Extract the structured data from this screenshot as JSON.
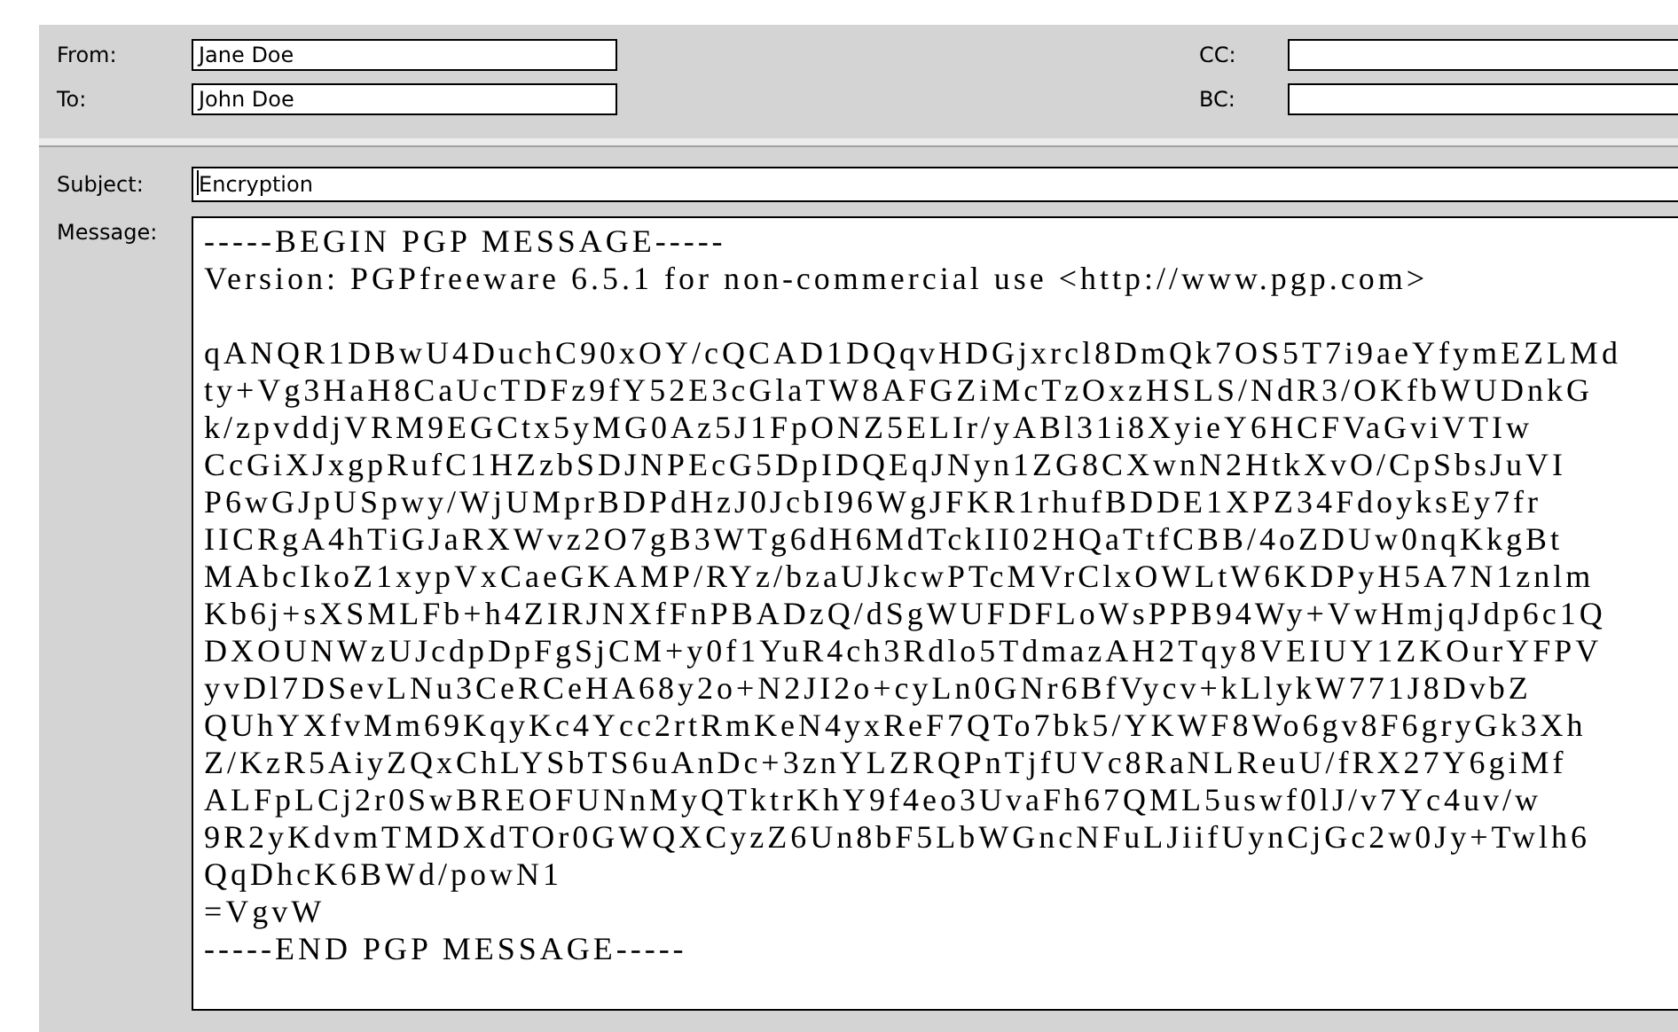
{
  "header": {
    "from": {
      "label": "From:",
      "value": "Jane Doe"
    },
    "to": {
      "label": "To:",
      "value": "John Doe"
    },
    "cc": {
      "label": "CC:"
    },
    "bc": {
      "label": "BC:"
    }
  },
  "subject": {
    "label": "Subject:",
    "value": "Encryption"
  },
  "message": {
    "label": "Message:",
    "value": "-----BEGIN PGP MESSAGE-----\nVersion: PGPfreeware 6.5.1 for non-commercial use <http://www.pgp.com>\n\nqANQR1DBwU4DuchC90xOY/cQCAD1DQqvHDGjxrcl8DmQk7OS5T7i9aeYfymEZLMd\nty+Vg3HaH8CaUcTDFz9fY52E3cGlaTW8AFGZiMcTzOxzHSLS/NdR3/OKfbWUDnkG\nk/zpvddjVRM9EGCtx5yMG0Az5J1FpONZ5ELIr/yABl31i8XyieY6HCFVaGviVTIw\nCcGiXJxgpRufC1HZzbSDJNPEcG5DpIDQEqJNyn1ZG8CXwnN2HtkXvO/CpSbsJuVI\nP6wGJpUSpwy/WjUMprBDPdHzJ0JcbI96WgJFKR1rhufBDDE1XPZ34FdoyksEy7fr\nIICRgA4hTiGJaRXWvz2O7gB3WTg6dH6MdTckII02HQaTtfCBB/4oZDUw0nqKkgBt\nMAbcIkoZ1xypVxCaeGKAMP/RYz/bzaUJkcwPTcMVrClxOWLtW6KDPyH5A7N1znlm\nKb6j+sXSMLFb+h4ZIRJNXfFnPBADzQ/dSgWUFDFLoWsPPB94Wy+VwHmjqJdp6c1Q\nDXOUNWzUJcdpDpFgSjCM+y0f1YuR4ch3Rdlo5TdmazAH2Tqy8VEIUY1ZKOurYFPV\nyvDl7DSevLNu3CeRCeHA68y2o+N2JI2o+cyLn0GNr6BfVycv+kLlykW771J8DvbZ\nQUhYXfvMm69KqyKc4Ycc2rtRmKeN4yxReF7QTo7bk5/YKWF8Wo6gv8F6gryGk3Xh\nZ/KzR5AiyZQxChLYSbTS6uAnDc+3znYLZRQPnTjfUVc8RaNLReuU/fRX27Y6giMf\nALFpLCj2r0SwBREOFUNnMyQTktrKhY9f4eo3UvaFh67QML5uswf0lJ/v7Yc4uv/w\n9R2yKdvmTMDXdTOr0GWQXCyzZ6Un8bF5LbWGncNFuLJiifUynCjGc2w0Jy+Twlh6\nQqDhcK6BWd/powN1\n=VgvW\n-----END PGP MESSAGE-----"
  }
}
